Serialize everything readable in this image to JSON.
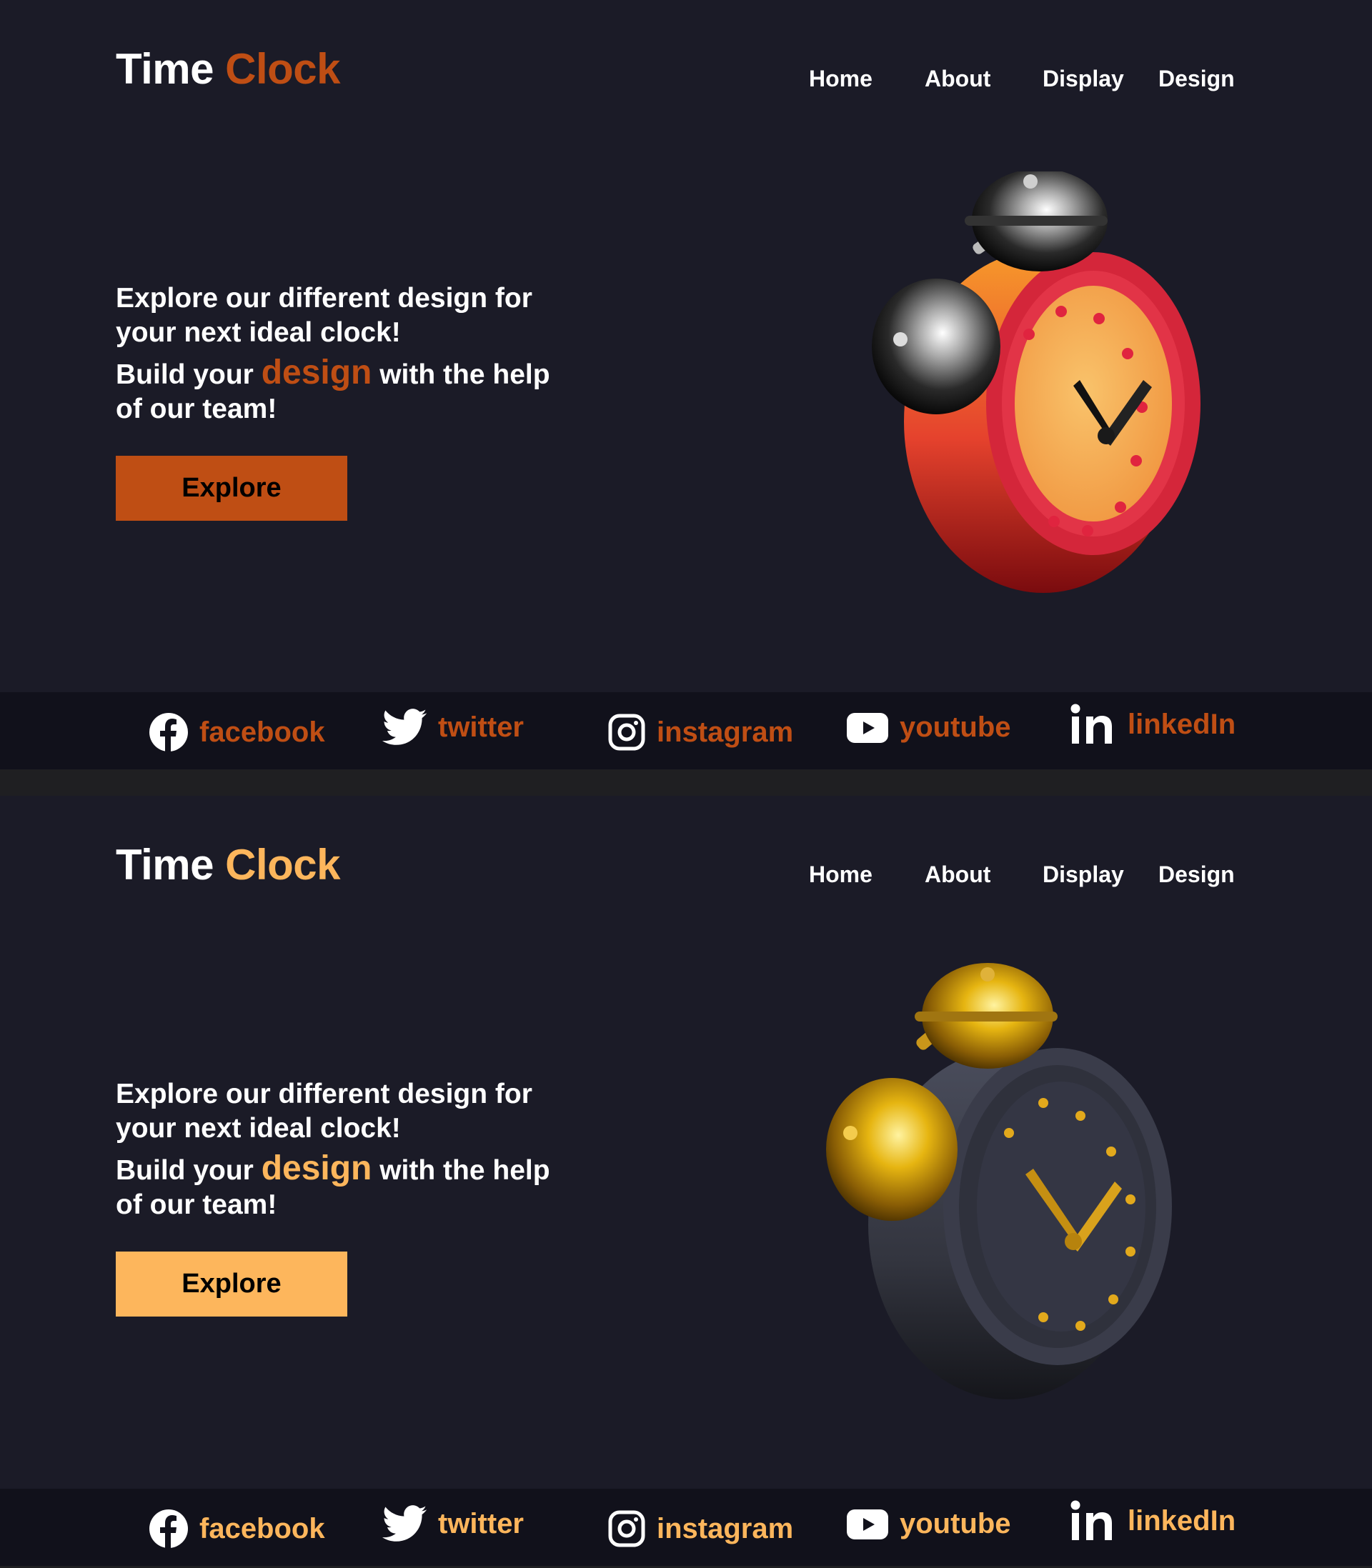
{
  "variants": [
    {
      "logo": {
        "word1": "Time",
        "word2": "Clock"
      },
      "nav": [
        "Home",
        "About",
        "Display",
        "Design"
      ],
      "headline": "Explore our different design for your next ideal clock!",
      "sub": {
        "before": "Build your",
        "accent": "design",
        "after": "with the help of our team!"
      },
      "explore_label": "Explore",
      "social": [
        "facebook",
        "twitter",
        "instagram",
        "youtube",
        "linkedIn"
      ],
      "accent_color": "#bf4e14",
      "clock_style": "red-orange with silver bells"
    },
    {
      "logo": {
        "word1": "Time",
        "word2": "Clock"
      },
      "nav": [
        "Home",
        "About",
        "Display",
        "Design"
      ],
      "headline": "Explore our different design for your next ideal clock!",
      "sub": {
        "before": "Build your",
        "accent": "design",
        "after": "with the help of our team!"
      },
      "explore_label": "Explore",
      "social": [
        "facebook",
        "twitter",
        "instagram",
        "youtube",
        "linkedIn"
      ],
      "accent_color": "#fdb65c",
      "social_color": "#fdb65c",
      "clock_style": "dark gray with gold bells"
    }
  ],
  "colors": {
    "background": "#1b1b27",
    "footer": "#11111b",
    "separator": "#1f1f22"
  },
  "icons": [
    "facebook-icon",
    "twitter-icon",
    "instagram-icon",
    "youtube-icon",
    "linkedin-icon"
  ]
}
